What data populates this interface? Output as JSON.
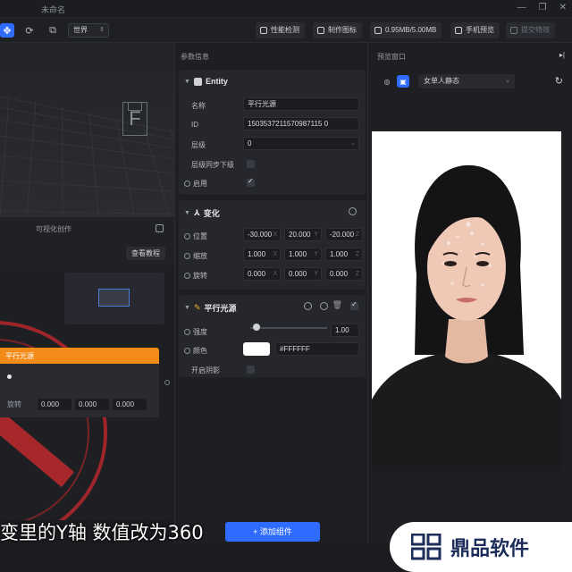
{
  "window": {
    "title": "未命名"
  },
  "toolbar": {
    "world_select": "世界",
    "perf_check": "性能检测",
    "make_icon": "制作图标",
    "size_usage": "0.95MB/5.00MB",
    "phone_preview": "手机预览",
    "submit_effect": "提交特效"
  },
  "left": {
    "visual_create_label": "可视化创作",
    "tutorial_button": "查看教程",
    "node": {
      "title": "平行光源",
      "rotate_label": "旋转",
      "rotate_values": [
        "0.000",
        "0.000",
        "0.000"
      ]
    }
  },
  "params": {
    "title": "参数信息",
    "entity": {
      "header": "Entity",
      "name_label": "名称",
      "name_value": "平行光源",
      "id_label": "ID",
      "id_value": "1503537211570987115 0",
      "layer_label": "层级",
      "layer_value": "0",
      "layer_sync_label": "层级同步下级",
      "enabled_label": "启用"
    },
    "transform": {
      "header": "变化",
      "position_label": "位置",
      "position_values": [
        "-30.000",
        "20.000",
        "-20.000"
      ],
      "scale_label": "缩放",
      "scale_values": [
        "1.000",
        "1.000",
        "1.000"
      ],
      "rotate_label": "旋转",
      "rotate_values": [
        "0.000",
        "0.000",
        "0.000"
      ],
      "axis_labels": [
        "X",
        "Y",
        "Z"
      ]
    },
    "light": {
      "header": "平行光源",
      "intensity_label": "强度",
      "intensity_value": "1.00",
      "intensity_fraction": 0.08,
      "color_label": "颜色",
      "color_hex_text": "#FFFFFF",
      "shadow_label": "开启阴影"
    },
    "add_component": "添加组件"
  },
  "preview": {
    "title": "预览窗口",
    "preset": "女单人静态"
  },
  "overlay": {
    "subtitle": "变里的Y轴 数值改为360",
    "logo_text": "鼎品软件"
  },
  "colors": {
    "accent": "#2f6bff",
    "node_header": "#f28b18",
    "swatch": "#ffffff"
  }
}
